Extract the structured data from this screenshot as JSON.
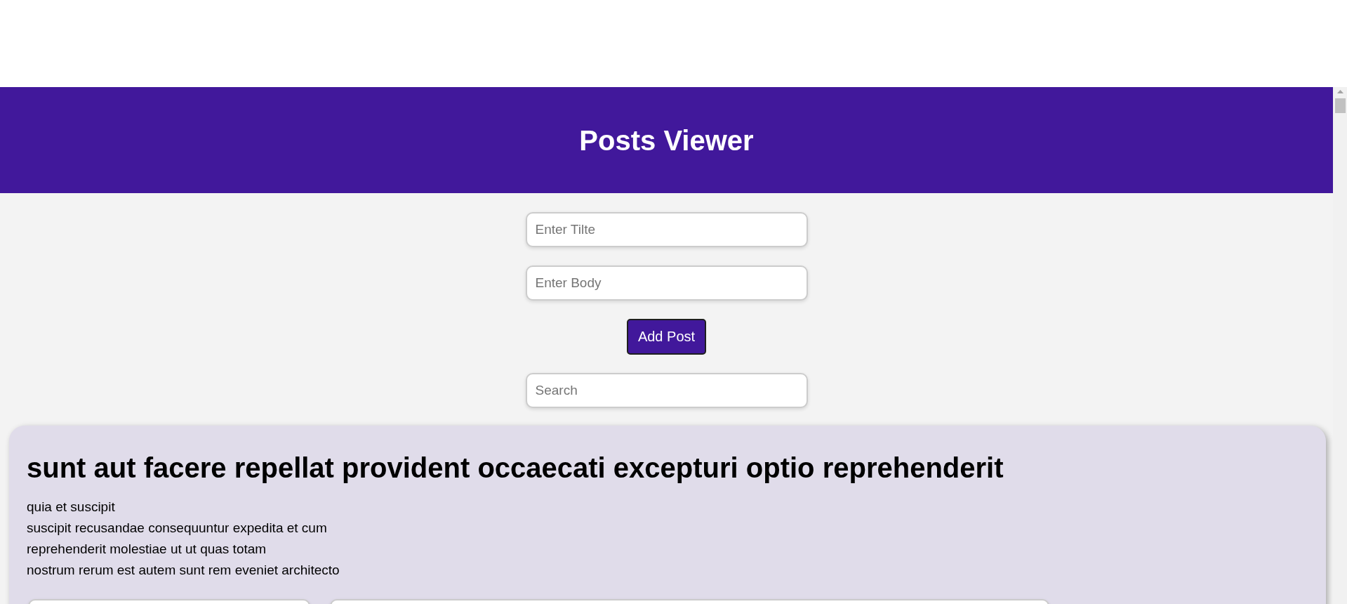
{
  "header": {
    "title": "Posts Viewer"
  },
  "form": {
    "title_field": {
      "placeholder": "Enter Tilte"
    },
    "body_field": {
      "placeholder": "Enter Body"
    },
    "add_button": "Add Post",
    "search_field": {
      "placeholder": "Search"
    }
  },
  "posts": [
    {
      "title": "sunt aut facere repellat provident occaecati excepturi optio reprehenderit",
      "body": "quia et suscipit\nsuscipit recusandae consequuntur expedita et cum\nreprehenderit molestiae ut ut quas totam\nnostrum rerum est autem sunt rem eveniet architecto",
      "edit_fields": [
        {
          "kind": "short"
        },
        {
          "kind": "wide"
        }
      ]
    }
  ]
}
